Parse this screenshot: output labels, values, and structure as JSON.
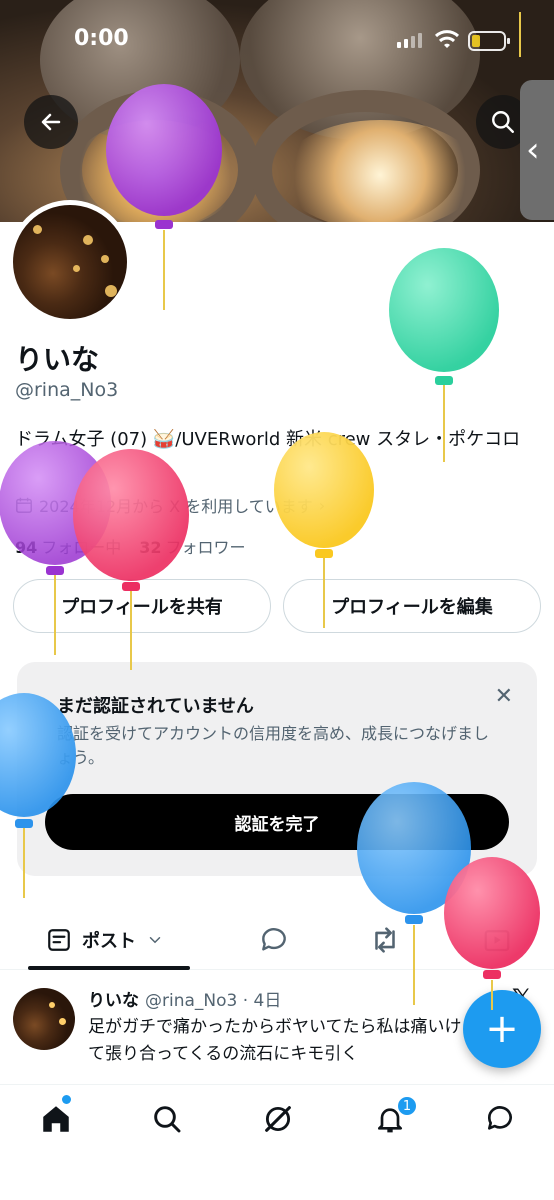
{
  "status_bar": {
    "time": "0:00"
  },
  "profile": {
    "name": "りいな",
    "handle": "@rina_No3",
    "bio": "ドラム女子 (07) 🥁/UVERworld 新米 crew スタレ・ポケコロ",
    "joined": "2024年12月から X を利用しています",
    "following_count": "94",
    "following_label": "フォロー中",
    "followers_count": "32",
    "followers_label": "フォロワー"
  },
  "buttons": {
    "share_profile": "プロフィールを共有",
    "edit_profile": "プロフィールを編集"
  },
  "verify_card": {
    "title": "まだ認証されていません",
    "description": "認証を受けてアカウントの信用度を高め、成長につなげましょう。",
    "cta": "認証を完了",
    "close": "✕"
  },
  "tabs": {
    "posts_label": "ポスト"
  },
  "post": {
    "author": "りいな",
    "meta": "@rina_No3 · 4日",
    "text": "足がガチで痛かったからボヤいてたら私は痛いけどねって張り合ってくるの流石にキモ引く",
    "x_logo": "𝕏"
  },
  "fab_label": "+",
  "notifications_badge": "1",
  "colors": {
    "accent": "#1d9bf0",
    "balloon_purple": "#a13fd8",
    "balloon_green": "#34d9a8",
    "balloon_pink": "#f03a6a",
    "balloon_yellow": "#fdd03a",
    "balloon_blue": "#33a0f0"
  }
}
